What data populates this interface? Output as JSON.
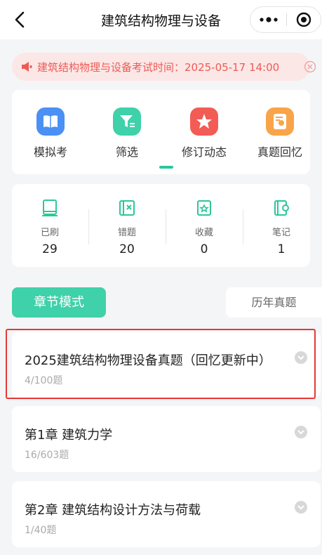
{
  "nav": {
    "title": "建筑结构物理与设备"
  },
  "notice": {
    "text": "建筑结构物理与设备考试时间：2025-05-17 14:00"
  },
  "features": [
    {
      "label": "模拟考",
      "color": "#4a90f5",
      "icon": "book-icon"
    },
    {
      "label": "筛选",
      "color": "#3fd1a9",
      "icon": "filter-icon"
    },
    {
      "label": "修订动态",
      "color": "#f25c54",
      "icon": "star-icon"
    },
    {
      "label": "真题回忆",
      "color": "#f9a44a",
      "icon": "paper-icon"
    }
  ],
  "stats": [
    {
      "label": "已刷",
      "value": "29",
      "icon": "book-outline-icon"
    },
    {
      "label": "错题",
      "value": "20",
      "icon": "wrong-icon"
    },
    {
      "label": "收藏",
      "value": "0",
      "icon": "collect-icon"
    },
    {
      "label": "笔记",
      "value": "1",
      "icon": "note-icon"
    }
  ],
  "tabs": {
    "active": "章节模式",
    "inactive": "历年真题"
  },
  "chapters": [
    {
      "title": "2025建筑结构物理设备真题（回忆更新中）",
      "count": "4/100题"
    },
    {
      "title": "第1章 建筑力学",
      "count": "16/603题"
    },
    {
      "title": "第2章 建筑结构设计方法与荷载",
      "count": "1/40题"
    }
  ],
  "colors": {
    "accent": "#3fd1a9",
    "notice": "#ec5b56",
    "highlight": "#e53935"
  }
}
